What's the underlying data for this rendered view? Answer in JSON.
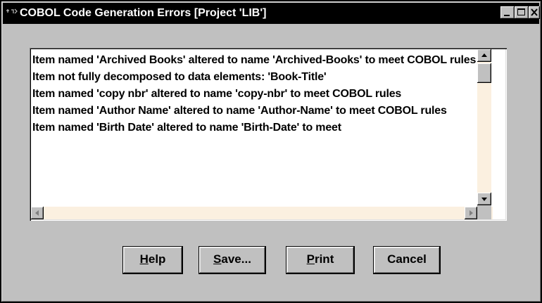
{
  "window": {
    "title": "COBOL Code Generation Errors [Project 'LIB']",
    "title_icon": "app-icon"
  },
  "messages": [
    "Item named 'Archived Books' altered to name 'Archived-Books' to meet COBOL rules",
    "Item not fully decomposed to data elements:  'Book-Title'",
    "Item named 'copy nbr' altered to name 'copy-nbr' to meet COBOL rules",
    "Item named 'Author Name' altered to name 'Author-Name' to meet COBOL rules",
    "Item named 'Birth Date' altered to name 'Birth-Date' to meet"
  ],
  "buttons": {
    "help": {
      "mnemonic": "H",
      "rest": "elp"
    },
    "save": {
      "mnemonic": "S",
      "rest": "ave..."
    },
    "print": {
      "mnemonic": "P",
      "rest": "rint"
    },
    "cancel": {
      "label": "Cancel"
    }
  },
  "colors": {
    "titlebar": "#000000",
    "face": "#c0c0c0",
    "scroll_track": "#fbf0e0"
  }
}
